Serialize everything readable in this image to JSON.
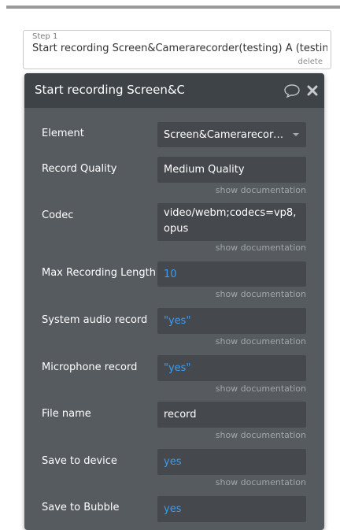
{
  "step": {
    "label": "Step 1",
    "title": "Start recording Screen&Camerarecorder(testing) A (testing)",
    "delete_label": "delete"
  },
  "panel": {
    "title": "Start recording Screen&Camerarecorder(testing) A",
    "doc_link": "show documentation",
    "fields": {
      "element": {
        "label": "Element",
        "value": "Screen&Camerarecorder(testing) A"
      },
      "record_quality": {
        "label": "Record Quality",
        "value": "Medium Quality"
      },
      "codec": {
        "label": "Codec",
        "value": "video/webm;codecs=vp8,opus"
      },
      "max_length": {
        "label": "Max Recording Length",
        "value": "10"
      },
      "system_audio": {
        "label": "System audio record",
        "value": "\"yes\""
      },
      "microphone": {
        "label": "Microphone record",
        "value": "\"yes\""
      },
      "file_name": {
        "label": "File name",
        "value": "record"
      },
      "save_device": {
        "label": "Save to device",
        "value": "yes"
      },
      "save_bubble": {
        "label": "Save to Bubble",
        "value": "yes"
      }
    }
  },
  "colors": {
    "panel_bg": "#565b5f",
    "header_bg": "#3e4347",
    "input_bg": "#45494d",
    "dynamic_value": "#3d9cf0"
  },
  "icons": {
    "comment": "comment-icon",
    "close": "close-icon",
    "dropdown": "chevron-down-icon"
  }
}
